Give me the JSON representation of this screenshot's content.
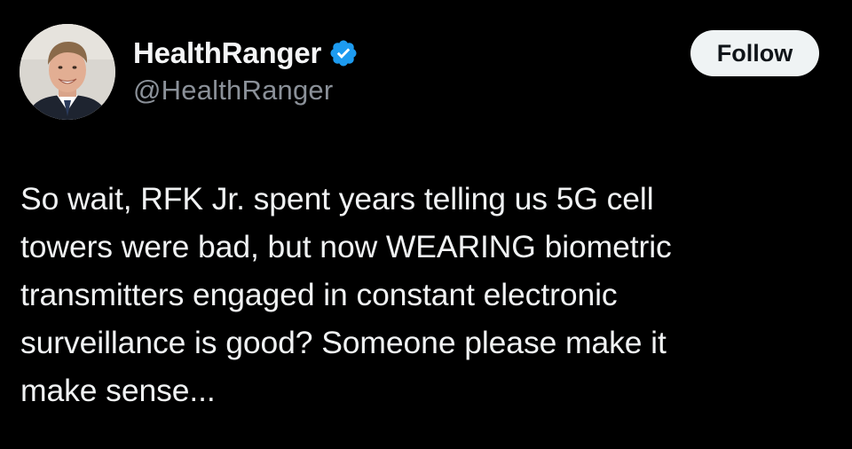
{
  "author": {
    "display_name": "HealthRanger",
    "handle": "@HealthRanger",
    "verified": true,
    "avatar_icon": "profile-photo-man-smiling"
  },
  "actions": {
    "follow_label": "Follow"
  },
  "tweet": {
    "text": "So wait, RFK Jr. spent years telling us 5G cell\ntowers were bad, but now WEARING biometric\ntransmitters engaged in constant electronic\nsurveillance is good? Someone please make it\nmake sense..."
  },
  "colors": {
    "background": "#000000",
    "text_primary": "#f0f2f3",
    "text_secondary": "#8b9199",
    "verified_badge": "#1d9bf0",
    "follow_button_bg": "#eff3f4",
    "follow_button_text": "#0f1419"
  }
}
